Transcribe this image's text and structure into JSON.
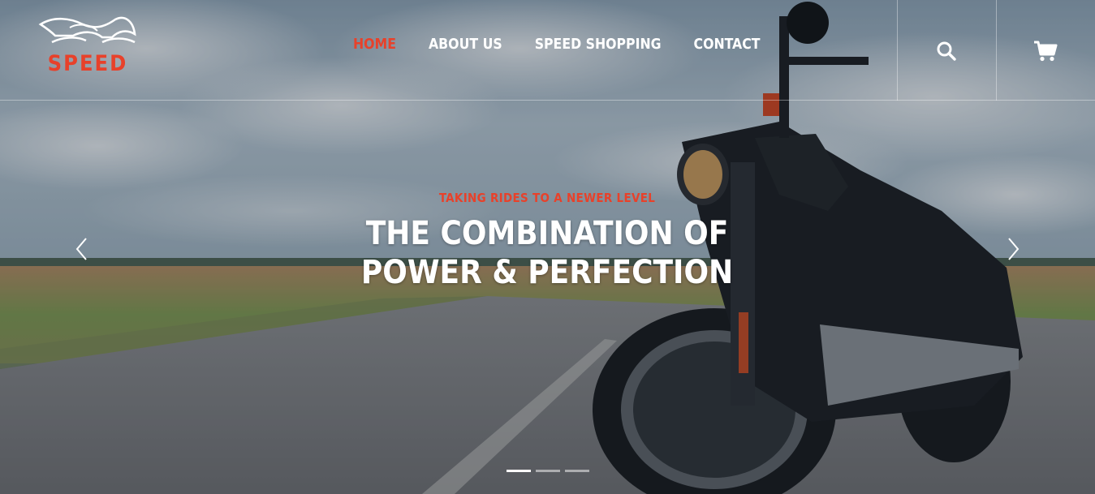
{
  "brand": {
    "name": "SPEED",
    "accent_color": "#e8412a"
  },
  "nav": {
    "items": [
      {
        "label": "HOME",
        "active": true
      },
      {
        "label": "ABOUT US",
        "active": false
      },
      {
        "label": "SPEED SHOPPING",
        "active": false
      },
      {
        "label": "CONTACT",
        "active": false
      }
    ]
  },
  "header_actions": {
    "search_icon": "search-icon",
    "cart_icon": "shopping-cart-icon"
  },
  "slide": {
    "kicker": "TAKING RIDES TO A NEWER LEVEL",
    "headline_line1": "THE COMBINATION OF",
    "headline_line2": "POWER & PERFECTION"
  },
  "carousel": {
    "prev_icon": "chevron-left-icon",
    "next_icon": "chevron-right-icon",
    "slide_count": 3,
    "active_index": 0
  },
  "background_image": "motorcycle-on-country-road"
}
